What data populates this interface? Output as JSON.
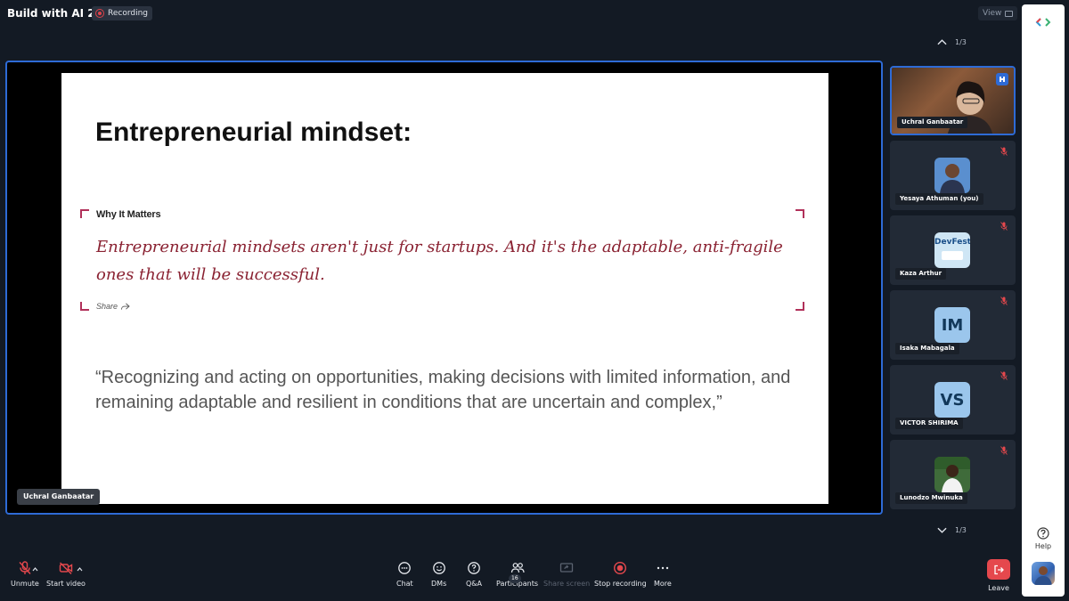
{
  "meeting": {
    "title": "Build with AI 2025",
    "recording_label": "Recording",
    "view_label": "View"
  },
  "slide": {
    "title": "Entrepreneurial mindset:",
    "why_label": "Why It Matters",
    "why_quote": "Entrepreneurial mindsets aren't just for startups. And it's the adaptable, anti-fragile ones that will be successful.",
    "share_label": "Share",
    "body_quote": "“Recognizing and acting on opportunities, making decisions with limited information, and remaining adaptable and resilient in conditions that are uncertain and complex,”",
    "presenter_name": "Uchral Ganbaatar"
  },
  "gallery": {
    "page_top": "1/3",
    "page_bottom": "1/3",
    "participants": [
      {
        "name": "Uchral Ganbaatar",
        "type": "video",
        "active": true
      },
      {
        "name": "Yesaya Athuman (you)",
        "type": "photo",
        "muted": true
      },
      {
        "name": "Kaza Arthur",
        "type": "photo",
        "muted": true,
        "photo_text": "DevFest"
      },
      {
        "name": "Isaka Mabagala",
        "type": "initials",
        "initials": "IM",
        "muted": true
      },
      {
        "name": "VICTOR SHIRIMA",
        "type": "initials",
        "initials": "VS",
        "muted": true
      },
      {
        "name": "Lunodzo Mwinuka",
        "type": "photo",
        "muted": true
      }
    ]
  },
  "sidebar": {
    "help_label": "Help"
  },
  "toolbar": {
    "unmute": "Unmute",
    "start_video": "Start video",
    "chat": "Chat",
    "dms": "DMs",
    "qa": "Q&A",
    "participants": "Participants",
    "participant_count": "16",
    "share_screen": "Share screen",
    "stop_recording": "Stop recording",
    "more": "More",
    "leave": "Leave"
  },
  "colors": {
    "accent": "#2e6bd6",
    "recording": "#e0424a",
    "muted": "#e5484d",
    "quote": "#8a2232",
    "corner": "#b1315a"
  }
}
